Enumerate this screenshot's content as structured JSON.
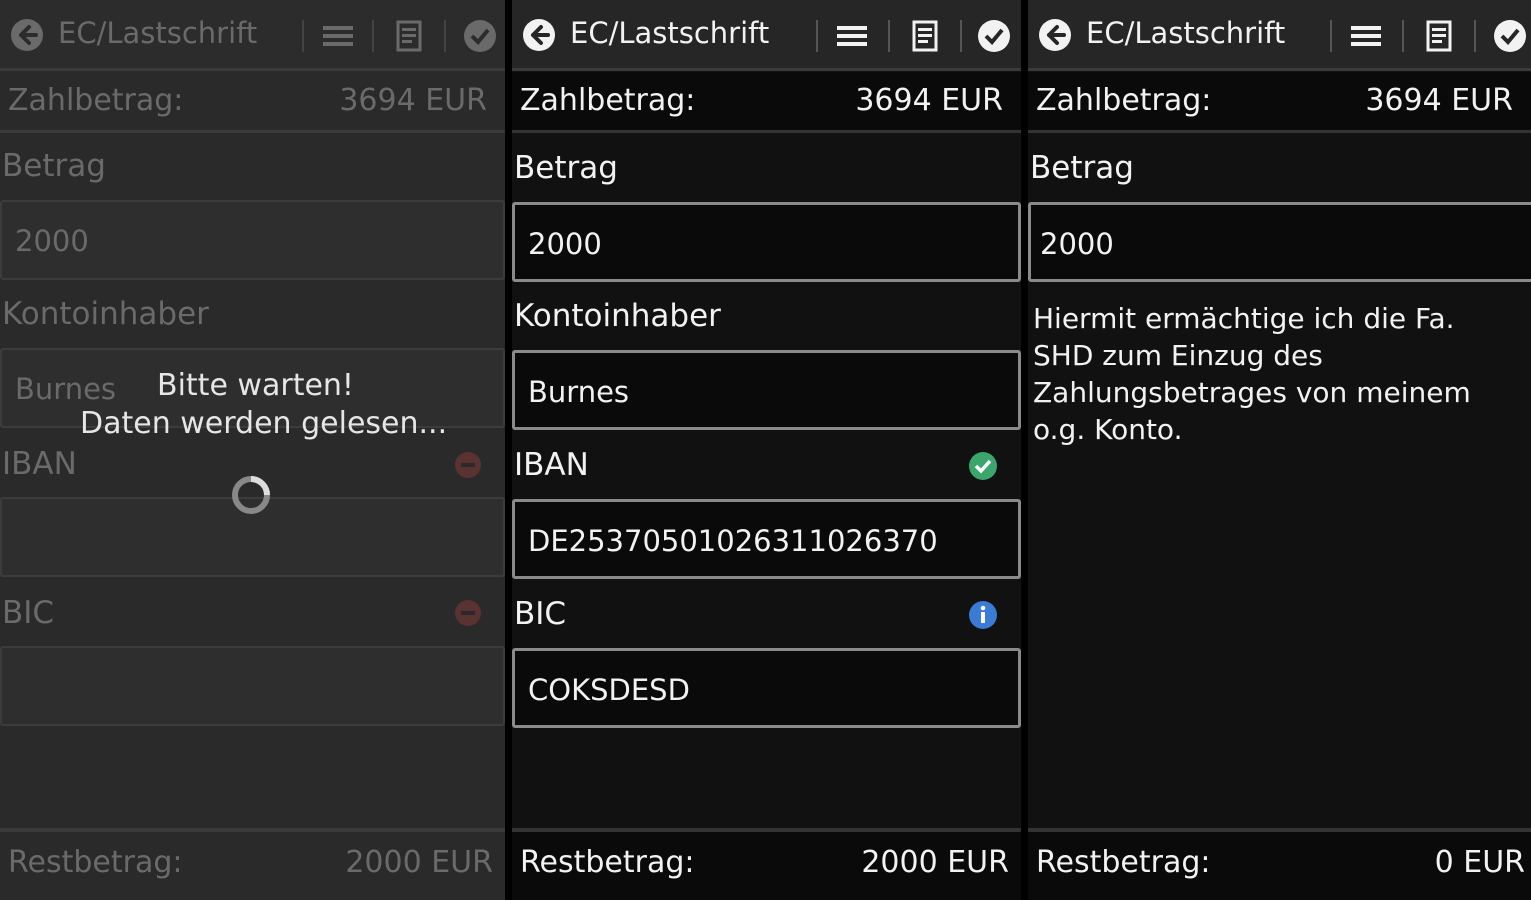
{
  "app": {
    "title": "EC/Lastschrift"
  },
  "icons": {
    "back": "arrow-back-icon",
    "menu": "menu-lines-icon",
    "document": "document-icon",
    "confirm": "checkmark-circle-icon",
    "iban_ok": "green-check-icon",
    "bic_info": "blue-info-icon",
    "not_valid": "red-minus-icon",
    "loading": "spinner-icon"
  },
  "colors": {
    "valid": "#3aa66b",
    "info": "#3a7bd5",
    "invalid": "#b04040"
  },
  "panels": {
    "loading": {
      "amount_label": "Zahlbetrag:",
      "amount_value": "3694 EUR",
      "betrag_label": "Betrag",
      "betrag_value": "2000",
      "holder_label": "Kontoinhaber",
      "holder_value": "Burnes",
      "iban_label": "IBAN",
      "bic_label": "BIC",
      "wait_title": "Bitte warten!",
      "wait_message": "Daten werden gelesen...",
      "rest_label": "Restbetrag:",
      "rest_value": "2000 EUR"
    },
    "form": {
      "amount_label": "Zahlbetrag:",
      "amount_value": "3694 EUR",
      "betrag_label": "Betrag",
      "betrag_value": "2000",
      "holder_label": "Kontoinhaber",
      "holder_value": "Burnes",
      "iban_label": "IBAN",
      "iban_value": "DE25370501026311026370",
      "bic_label": "BIC",
      "bic_value": "COKSDESD",
      "rest_label": "Restbetrag:",
      "rest_value": "2000 EUR"
    },
    "mandate": {
      "amount_label": "Zahlbetrag:",
      "amount_value": "3694 EUR",
      "betrag_label": "Betrag",
      "betrag_value": "2000",
      "mandate_text": "Hiermit ermächtige ich die Fa. SHD zum Einzug des Zahlungsbetrages von meinem o.g. Konto.",
      "rest_label": "Restbetrag:",
      "rest_value": "0 EUR"
    }
  }
}
